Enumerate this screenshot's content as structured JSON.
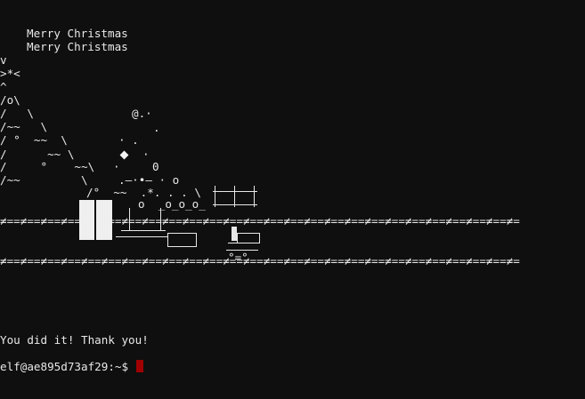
{
  "colors": {
    "background": "#0f0f0f",
    "text": "#e8e8e8",
    "cursor": "#a00000"
  },
  "greeting": {
    "line1": "Merry Christmas",
    "line2": "Merry Christmas"
  },
  "tree": {
    "rows": [
      "v",
      ">*<",
      "^",
      "/o\\",
      "/   \\",
      "/~~   \\",
      "/ °  ~~  \\",
      "/      ~~ \\",
      "/     °    ~~\\",
      "/~~         \\"
    ]
  },
  "snow": {
    "a": "@.·",
    "b": ".",
    "c": "· .",
    "d": "·",
    "e": "·",
    "f": "0",
    "g": ".—·•— · o",
    "h": "/°  ~~  .*. . . \\",
    "i": "o  _o_o_o_"
  },
  "rails": {
    "top": "≠==≠==≠==≠==≠==≠==≠==≠==≠==≠==≠==≠==≠==≠==≠==≠==≠==≠==≠==≠==≠==≠==≠==≠==≠==≠==≠==≠==≠==≠==≠==≠==≠==≠==≠",
    "bottom": "≠==≠==≠==≠==≠==≠==≠==≠==≠==≠==≠==≠==≠==≠==≠==≠==≠==≠==≠==≠==≠==≠==≠==≠==≠==≠==≠==≠==≠==≠==≠==≠==≠==≠==≠",
    "bottom_mid": "°=°"
  },
  "message": "You did it! Thank you!",
  "prompt": {
    "text": "elf@ae895d73af29:~$"
  }
}
